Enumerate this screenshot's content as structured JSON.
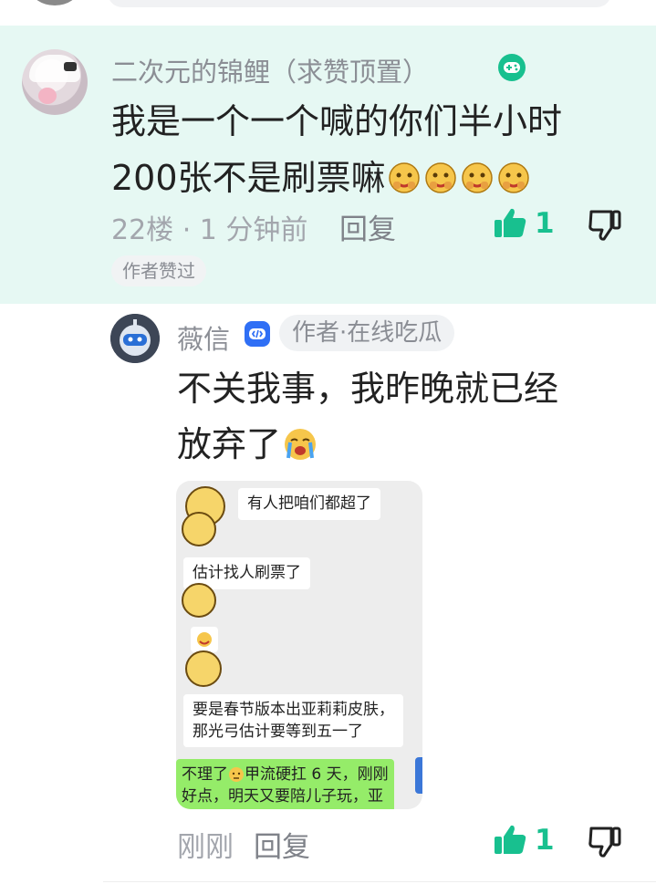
{
  "comment": {
    "username": "二次元的锦鲤（求赞顶置）",
    "text_line1": "我是一个一个喊的你们半小时",
    "text_line2": "200张不是刷票嘛",
    "meta": "22楼 · 1 分钟前",
    "reply_label": "回复",
    "like_count": "1",
    "author_liked_tag": "作者赞过"
  },
  "reply": {
    "username": "薇信",
    "author_tag": "作者·在线吃瓜",
    "text_line1": "不关我事，我昨晚就已经",
    "text_line2": "放弃了",
    "time": "刚刚",
    "reply_label": "回复",
    "like_count": "1",
    "screenshot": {
      "msg1": "有人把咱们都超了",
      "msg2": "估计找人刷票了",
      "msg3_line1": "要是春节版本出亚莉莉皮肤，",
      "msg3_line2": "那光弓估计要等到五一了",
      "msg4_pre": "不理了",
      "msg4_post": "甲流硬扛 6 天，刚刚",
      "msg4_line2": "好点，明天又要陪儿子玩，亚"
    }
  },
  "colors": {
    "accent": "#18c08f",
    "highlight_bg": "#e6f8f3",
    "muted_text": "#8b8e95",
    "verified_blue": "#2f6ff5"
  },
  "icons": {
    "game_badge": "gamepad-icon",
    "verified_badge": "verified-icon",
    "like": "thumbs-up-icon",
    "dislike": "thumbs-down-icon"
  }
}
